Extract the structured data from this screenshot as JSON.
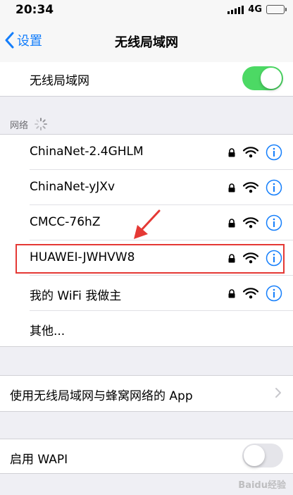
{
  "status_bar": {
    "time": "20:34",
    "network_type": "4G"
  },
  "nav": {
    "back_label": "设置",
    "title": "无线局域网"
  },
  "wlan": {
    "label": "无线局域网",
    "enabled": true
  },
  "section": {
    "networks_header": "网络"
  },
  "networks": [
    {
      "name": "ChinaNet-2.4GHLM",
      "locked": true
    },
    {
      "name": "ChinaNet-yJXv",
      "locked": true
    },
    {
      "name": "CMCC-76hZ",
      "locked": true
    },
    {
      "name": "HUAWEI-JWHVW8",
      "locked": true,
      "highlighted": true
    },
    {
      "name": "我的 WiFi 我做主",
      "locked": true
    },
    {
      "name": "其他..."
    }
  ],
  "apps_row": {
    "label": "使用无线局域网与蜂窝网络的 App"
  },
  "wapi": {
    "label": "启用 WAPI",
    "enabled": false
  },
  "watermark": {
    "text": "Baidu经验"
  },
  "colors": {
    "accent": "#147efb",
    "toggle_on": "#4cd964",
    "highlight": "#e53935"
  }
}
